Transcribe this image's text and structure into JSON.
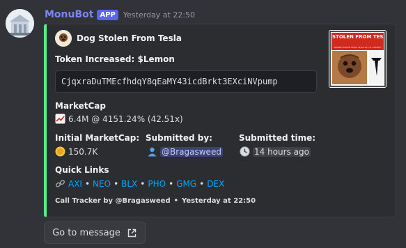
{
  "message": {
    "username": "MonuBot",
    "app_tag": "APP",
    "timestamp": "Yesterday at 22:50"
  },
  "embed": {
    "accent_color": "#57f287",
    "author": "Dog Stolen From Tesla",
    "token_label": "Token Increased: $Lemon",
    "contract_address": "CjqxraDuTMEcfhdqY8qEaMY43icdBrkt3EXciNVpump",
    "marketcap": {
      "title": "MarketCap",
      "value": "6.4M @ 4151.24% (42.51x)",
      "icon": "chart-increasing-icon"
    },
    "initial_marketcap": {
      "title": "Initial MarketCap:",
      "value": "150.7K",
      "icon": "coin-icon"
    },
    "submitted_by": {
      "title": "Submitted by:",
      "value": "@Bragasweed",
      "icon": "bust-icon"
    },
    "submitted_time": {
      "title": "Submitted time:",
      "value": "14 hours ago",
      "icon": "clock-icon"
    },
    "quick_links": {
      "title": "Quick Links",
      "items": [
        "AXI",
        "NEO",
        "BLX",
        "PHO",
        "GMG",
        "DEX"
      ],
      "separator": "•",
      "icon": "link-icon"
    },
    "footer": {
      "text": "Call Tracker by @Bragasweed",
      "separator": "•",
      "timestamp": "Yesterday at 22:50"
    },
    "thumbnail": {
      "headline": "STOLEN FROM TESLA",
      "caption": "LEMON STOLEN FROM TESLA IN L.A. COUNTY"
    }
  },
  "actions": {
    "goto_label": "Go to message"
  }
}
